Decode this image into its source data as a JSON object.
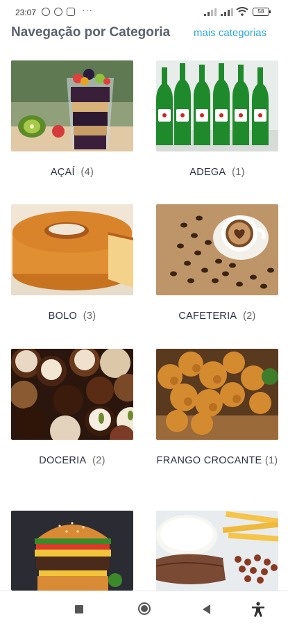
{
  "status_bar": {
    "time": "23:07",
    "more_indicator": "···",
    "battery_level": "58"
  },
  "header": {
    "title": "Navegação por Categoria",
    "more_link": "mais categorias"
  },
  "categories": [
    {
      "name": "AÇAÍ",
      "count": "(4)",
      "image": "acai-cup"
    },
    {
      "name": "ADEGA",
      "count": "(1)",
      "image": "beer-bottles"
    },
    {
      "name": "BOLO",
      "count": "(3)",
      "image": "bundt-cake"
    },
    {
      "name": "CAFETERIA",
      "count": "(2)",
      "image": "coffee-cup-beans"
    },
    {
      "name": "DOCERIA",
      "count": "(2)",
      "image": "chocolate-bonbons"
    },
    {
      "name": "FRANGO CROCANTE",
      "count": "(1)",
      "image": "fried-chicken"
    },
    {
      "name": "",
      "count": "",
      "image": "burger"
    },
    {
      "name": "",
      "count": "",
      "image": "rice-steak-fries"
    }
  ],
  "nav_bar": {
    "icons": [
      "recents-square-icon",
      "home-circle-icon",
      "back-triangle-icon",
      "accessibility-icon"
    ]
  },
  "colors": {
    "accent_link": "#29a8e0",
    "title_gray": "#5c6070",
    "caption_text": "#2d2f45"
  }
}
